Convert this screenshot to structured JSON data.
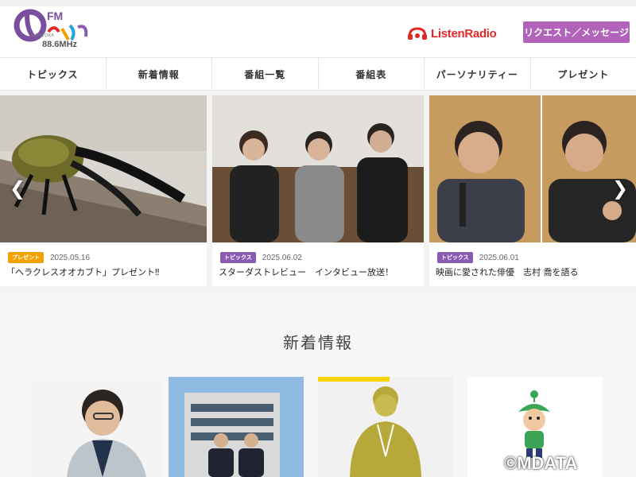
{
  "header": {
    "logo": {
      "fm": "FM",
      "freq": "88.6MHz",
      "sub": "NOBEOKA"
    },
    "listen_radio": "ListenRadio",
    "request_button": "リクエスト／メッセージ"
  },
  "nav": [
    "トピックス",
    "新着情報",
    "番組一覧",
    "番組表",
    "パーソナリティー",
    "プレゼント"
  ],
  "slider": {
    "prev": "❮",
    "next": "❯",
    "cards": [
      {
        "tag": "プレゼント",
        "tag_color": "#f2a200",
        "date": "2025.05.16",
        "title": "「ヘラクレスオオカブト」プレゼント‼"
      },
      {
        "tag": "トピックス",
        "tag_color": "#8a5ab0",
        "date": "2025.06.02",
        "title": "スターダストレビュー　インタビュー放送！"
      },
      {
        "tag": "トピックス",
        "tag_color": "#8a5ab0",
        "date": "2025.06.01",
        "title": "映画に愛された俳優　志村 喬を語る"
      }
    ]
  },
  "news": {
    "title": "新着情報"
  },
  "copyright": "©MDATA",
  "colors": {
    "accent": "#b063b8",
    "listen_red": "#e2292a",
    "present": "#f2a200",
    "topics": "#8a5ab0"
  }
}
